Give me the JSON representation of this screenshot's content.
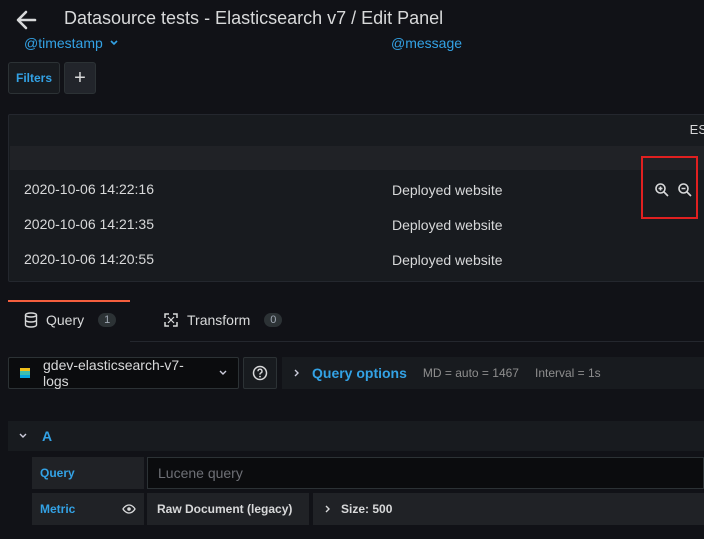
{
  "header": {
    "title": "Datasource tests - Elasticsearch v7 / Edit Panel"
  },
  "filters": {
    "label": "Filters",
    "add_label": "+"
  },
  "panel": {
    "title": "ES",
    "columns": [
      "@timestamp",
      "@message"
    ],
    "rows": [
      [
        "2020-10-06 14:22:16",
        "Deployed website"
      ],
      [
        "2020-10-06 14:21:35",
        "Deployed website"
      ],
      [
        "2020-10-06 14:20:55",
        "Deployed website"
      ]
    ]
  },
  "tabs": [
    {
      "label": "Query",
      "count": "1",
      "active": true
    },
    {
      "label": "Transform",
      "count": "0",
      "active": false
    }
  ],
  "query_row": {
    "datasource": "gdev-elasticsearch-v7-logs",
    "options_label": "Query options",
    "md": "MD = auto = 1467",
    "interval": "Interval = 1s"
  },
  "query": {
    "ref_id": "A",
    "query_label": "Query",
    "query_placeholder": "Lucene query",
    "metric_label": "Metric",
    "metric_value": "Raw Document (legacy)",
    "size_label": "Size: 500"
  },
  "colors": {
    "accent_blue": "#33a2e5",
    "tab_active": "#f55f3e",
    "highlight_red": "#e02020"
  }
}
